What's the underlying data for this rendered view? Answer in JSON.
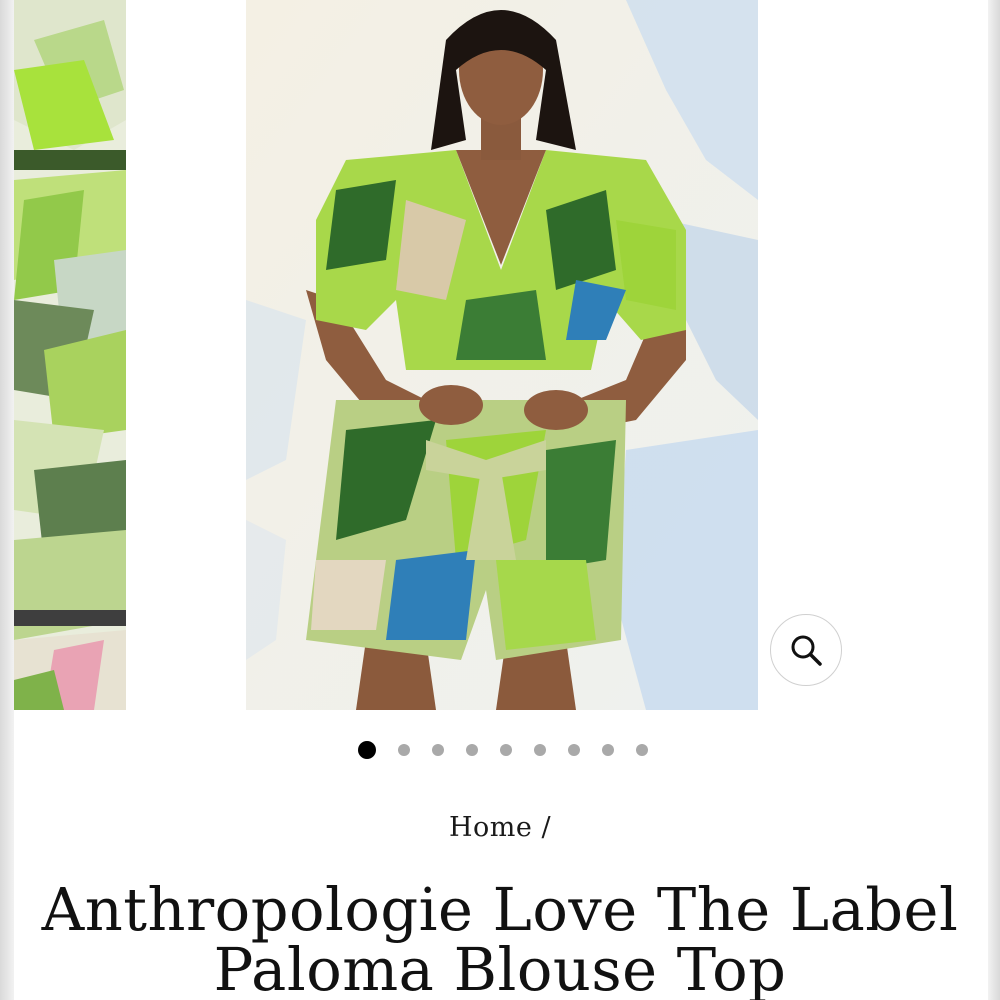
{
  "breadcrumb": {
    "home_label": "Home",
    "separator": "/"
  },
  "product": {
    "title": "Anthropologie Love The Label Paloma Blouse Top"
  },
  "gallery": {
    "slide_count": 9,
    "active_slide": 1,
    "zoom_icon": "search-icon"
  },
  "colors": {
    "background": "#ffffff",
    "dot_active": "#000000",
    "dot_inactive": "#a9a9a9",
    "print_lime": "#9ed43a",
    "print_green": "#2f6b2a",
    "print_blue": "#2f7fb8"
  }
}
